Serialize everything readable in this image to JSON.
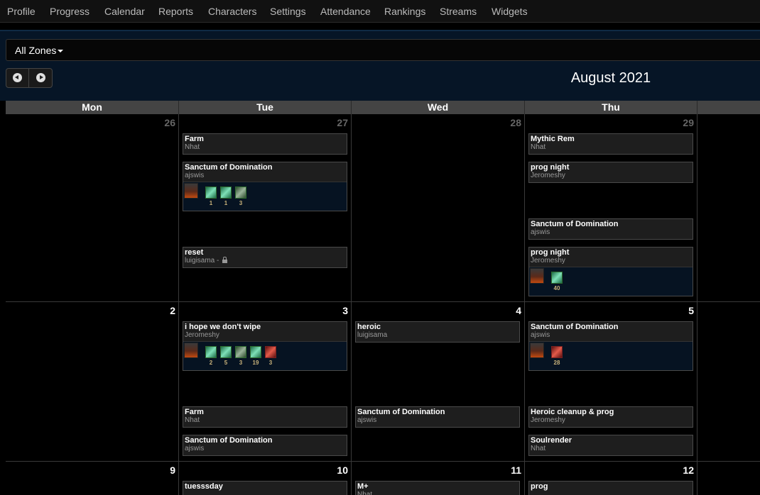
{
  "nav": {
    "items": [
      "Profile",
      "Progress",
      "Calendar",
      "Reports",
      "Characters",
      "Settings",
      "Attendance",
      "Rankings",
      "Streams",
      "Widgets"
    ]
  },
  "zones": {
    "label": "All Zones"
  },
  "toolbar": {
    "prev_icon": "chevron-left-icon",
    "next_icon": "chevron-right-icon"
  },
  "calendar": {
    "month_title": "August 2021",
    "weekdays": [
      "Mon",
      "Tue",
      "Wed",
      "Thu"
    ],
    "weeks": [
      {
        "days": [
          {
            "num": "26",
            "other": true,
            "events": []
          },
          {
            "num": "27",
            "other": true,
            "events": [
              {
                "title": "Farm",
                "sub": "Nhat"
              },
              {
                "title": "Sanctum of Domination",
                "sub": "ajswis",
                "roster": [
                  {
                    "role": "heal",
                    "count": "1"
                  },
                  {
                    "role": "heal",
                    "count": "1"
                  },
                  {
                    "role": "tank",
                    "count": "3"
                  }
                ]
              },
              {
                "title": "reset",
                "sub": "luigisama - ",
                "locked": true
              }
            ]
          },
          {
            "num": "28",
            "other": true,
            "events": []
          },
          {
            "num": "29",
            "other": true,
            "events": [
              {
                "title": "Mythic Rem",
                "sub": "Nhat"
              },
              {
                "title": "prog night",
                "sub": "Jeromeshy"
              },
              {
                "title": "Sanctum of Domination",
                "sub": "ajswis"
              },
              {
                "title": "prog night",
                "sub": "Jeromeshy",
                "roster": [
                  {
                    "role": "heal",
                    "count": "40"
                  }
                ]
              }
            ]
          }
        ]
      },
      {
        "days": [
          {
            "num": "2",
            "other": false,
            "events": []
          },
          {
            "num": "3",
            "other": false,
            "events": [
              {
                "title": "i hope we don't wipe",
                "sub": "Jeromeshy",
                "roster": [
                  {
                    "role": "heal",
                    "count": "2"
                  },
                  {
                    "role": "heal",
                    "count": "5"
                  },
                  {
                    "role": "tank",
                    "count": "3"
                  },
                  {
                    "role": "heal",
                    "count": "19"
                  },
                  {
                    "role": "dps",
                    "count": "3"
                  }
                ]
              },
              {
                "title": "Farm",
                "sub": "Nhat"
              },
              {
                "title": "Sanctum of Domination",
                "sub": "ajswis"
              }
            ]
          },
          {
            "num": "4",
            "other": false,
            "events": [
              {
                "title": "heroic",
                "sub": "luigisama"
              },
              {
                "title": "Sanctum of Domination",
                "sub": "ajswis"
              }
            ]
          },
          {
            "num": "5",
            "other": false,
            "events": [
              {
                "title": "Sanctum of Domination",
                "sub": "ajswis",
                "roster": [
                  {
                    "role": "dps",
                    "count": "28"
                  }
                ]
              },
              {
                "title": "Heroic cleanup & prog",
                "sub": "Jeromeshy"
              },
              {
                "title": "Soulrender",
                "sub": "Nhat"
              }
            ]
          }
        ]
      },
      {
        "days": [
          {
            "num": "9",
            "other": false,
            "events": []
          },
          {
            "num": "10",
            "other": false,
            "events": [
              {
                "title": "tuesssday",
                "sub": ""
              }
            ]
          },
          {
            "num": "11",
            "other": false,
            "events": [
              {
                "title": "M+",
                "sub": "Nhat"
              }
            ]
          },
          {
            "num": "12",
            "other": false,
            "events": [
              {
                "title": "prog",
                "sub": ""
              }
            ]
          }
        ]
      }
    ]
  }
}
